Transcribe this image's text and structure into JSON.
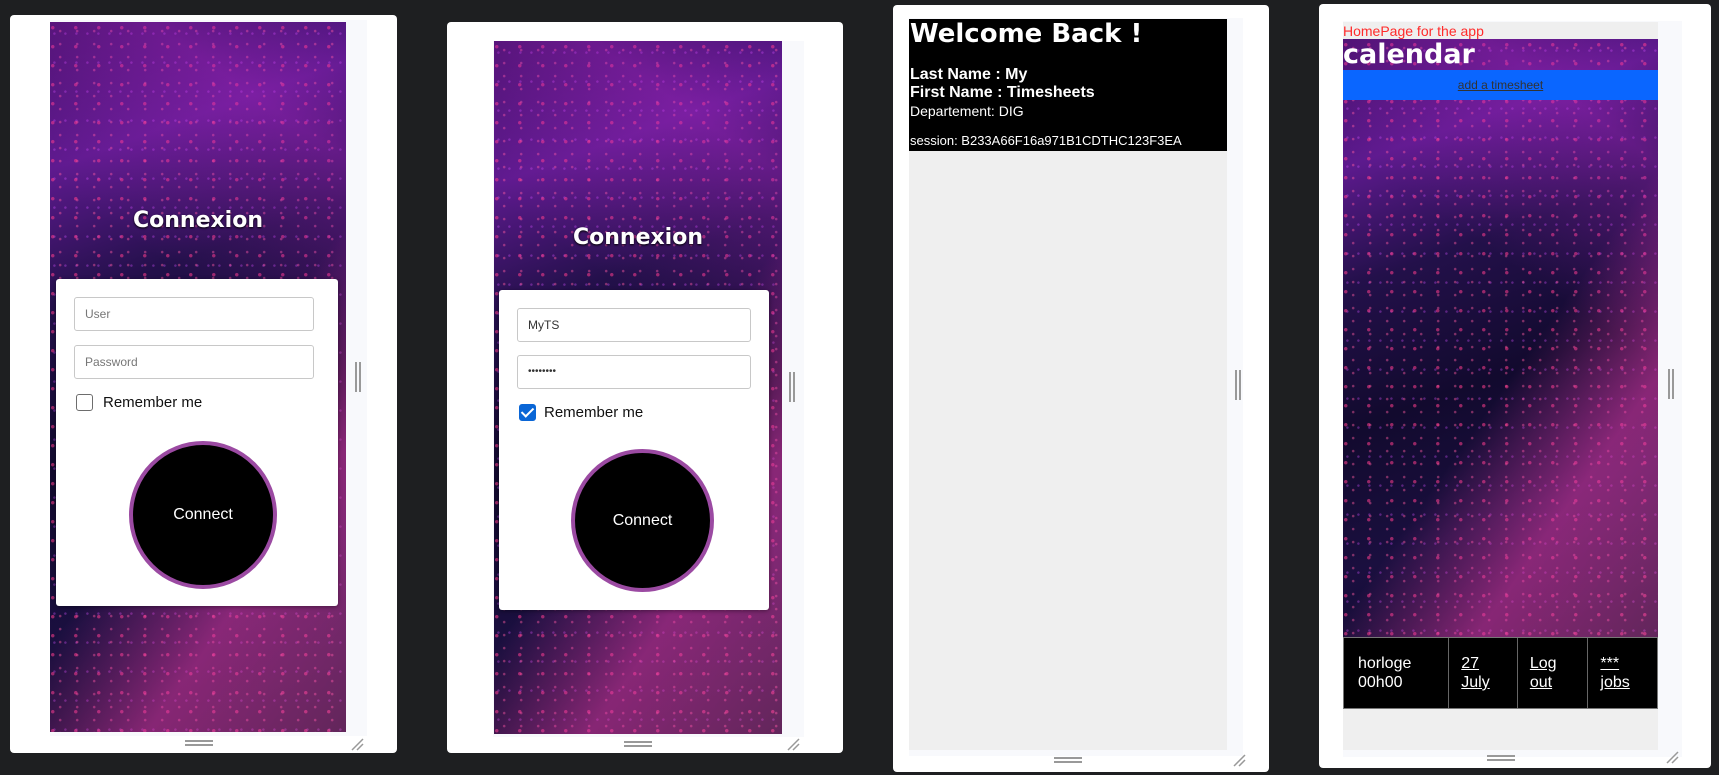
{
  "colors": {
    "accent_purple": "#9b4aa2",
    "checkbox_blue": "#0a66d6",
    "add_bar_blue": "#0a66ff",
    "homepage_red": "#ff2a2a"
  },
  "login1": {
    "title": "Connexion",
    "user_placeholder": "User",
    "password_placeholder": "Password",
    "remember_label": "Remember me",
    "remember_checked": false,
    "connect_label": "Connect"
  },
  "login2": {
    "title": "Connexion",
    "user_value": "MyTS",
    "password_value": "••••••••",
    "remember_label": "Remember me",
    "remember_checked": true,
    "connect_label": "Connect"
  },
  "welcome": {
    "heading": "Welcome Back !",
    "last_name": "Last Name : My",
    "first_name": "First Name : Timesheets",
    "department": "Departement: DIG",
    "session": "session: B233A66F16a971B1CDTHC123F3EA"
  },
  "home": {
    "homepage_text": "HomePage for the app",
    "calendar_title": "calendar",
    "add_timesheet": "add a timesheet",
    "clock": "horloge 00h00",
    "date": "27 July",
    "logout": "Log out",
    "jobs": "*** jobs"
  }
}
